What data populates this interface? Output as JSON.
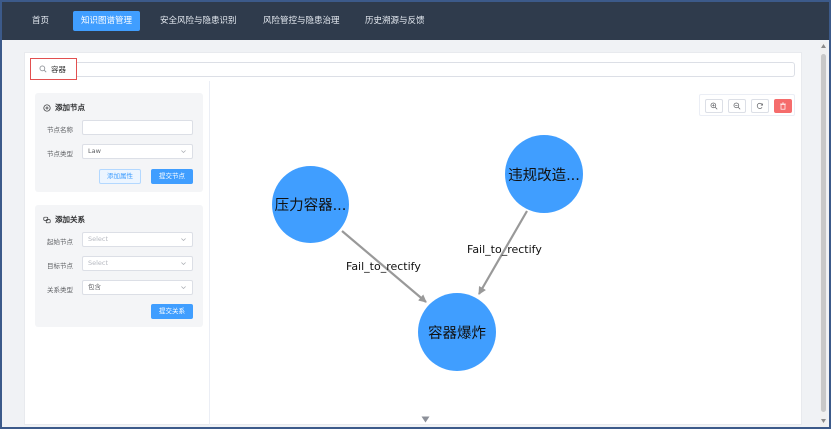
{
  "nav": {
    "items": [
      {
        "label": "首页",
        "active": false
      },
      {
        "label": "知识图谱管理",
        "active": true
      },
      {
        "label": "安全风险与隐患识别",
        "active": false
      },
      {
        "label": "风险管控与隐患治理",
        "active": false
      },
      {
        "label": "历史溯源与反馈",
        "active": false
      }
    ]
  },
  "search": {
    "value": "容器",
    "icon": "search-icon"
  },
  "add_node": {
    "title": "添加节点",
    "name_label": "节点名称",
    "name_value": "",
    "type_label": "节点类型",
    "type_value": "Law",
    "add_attr_button": "添加属性",
    "submit_button": "提交节点"
  },
  "add_relation": {
    "title": "添加关系",
    "start_label": "起始节点",
    "start_placeholder": "Select",
    "target_label": "目标节点",
    "target_placeholder": "Select",
    "relation_type_label": "关系类型",
    "relation_type_value": "包含",
    "submit_button": "提交关系"
  },
  "graph": {
    "nodes": [
      {
        "id": "n1",
        "label": "压力容器..."
      },
      {
        "id": "n2",
        "label": "违规改造..."
      },
      {
        "id": "n3",
        "label": "容器爆炸"
      }
    ],
    "edges": [
      {
        "from": "n1",
        "to": "n3",
        "label": "Fail_to_rectify"
      },
      {
        "from": "n2",
        "to": "n3",
        "label": "Fail_to_rectify"
      }
    ],
    "toolbar": [
      "zoom-in-icon",
      "zoom-out-icon",
      "refresh-icon",
      "delete-icon"
    ]
  },
  "colors": {
    "nav_bg": "#2f3b4c",
    "accent": "#409eff",
    "danger": "#f56c6c",
    "edge": "#999999"
  }
}
